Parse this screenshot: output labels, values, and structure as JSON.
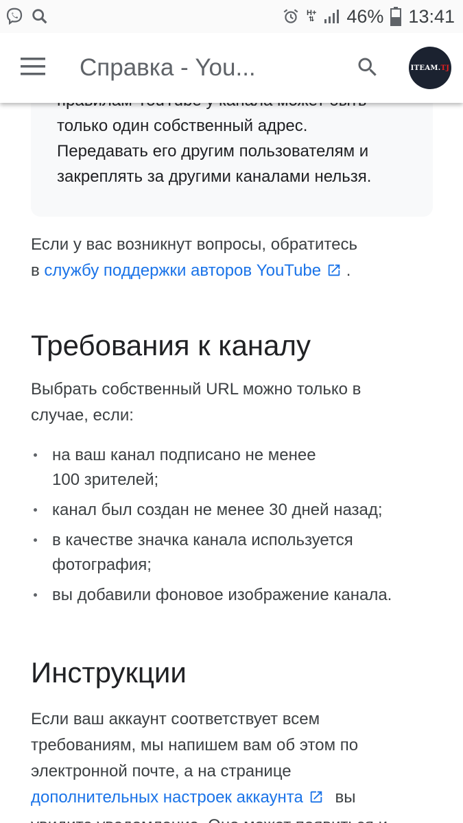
{
  "status_bar": {
    "network": "H+",
    "battery_percent": "46%",
    "time": "13:41",
    "icons": [
      "viber-icon",
      "search-notification-icon",
      "alarm-icon",
      "network-h-plus-icon",
      "signal-icon",
      "battery-icon"
    ]
  },
  "app_bar": {
    "title": "Справка - You...",
    "avatar_text_white": "ITEAM.",
    "avatar_text_red": "TJ"
  },
  "note": {
    "lines": [
      "правилам YouTube у канала может быть",
      "только один собственный адрес.",
      "Передавать его другим пользователям и",
      "закреплять за другими каналами нельзя."
    ]
  },
  "support": {
    "line1": "Если у вас возникнут вопросы, обратитесь",
    "line2_prefix": "в",
    "link_text": "службу поддержки авторов YouTube",
    "line2_suffix": "."
  },
  "requirements": {
    "heading": "Требования к каналу",
    "intro_line1": "Выбрать собственный URL можно только в",
    "intro_line2": "случае, если:",
    "items": [
      [
        "на ваш канал подписано не менее",
        "100 зрителей;"
      ],
      [
        "канал был создан не менее 30 дней назад;"
      ],
      [
        "в качестве значка канала используется",
        "фотография;"
      ],
      [
        "вы добавили фоновое изображение канала."
      ]
    ]
  },
  "instructions": {
    "heading": "Инструкции",
    "line1": "Если ваш аккаунт соответствует всем",
    "line2": "требованиям, мы напишем вам об этом по",
    "line3": "электронной почте, а на странице",
    "link_text": "дополнительных настроек аккаунта",
    "line4_suffix": "вы",
    "line5": "увидите уведомление. Оно может появиться и"
  },
  "colors": {
    "link": "#1a73e8",
    "text": "#202124",
    "secondary_text": "#3c4043",
    "note_background": "#f8f9fa"
  }
}
